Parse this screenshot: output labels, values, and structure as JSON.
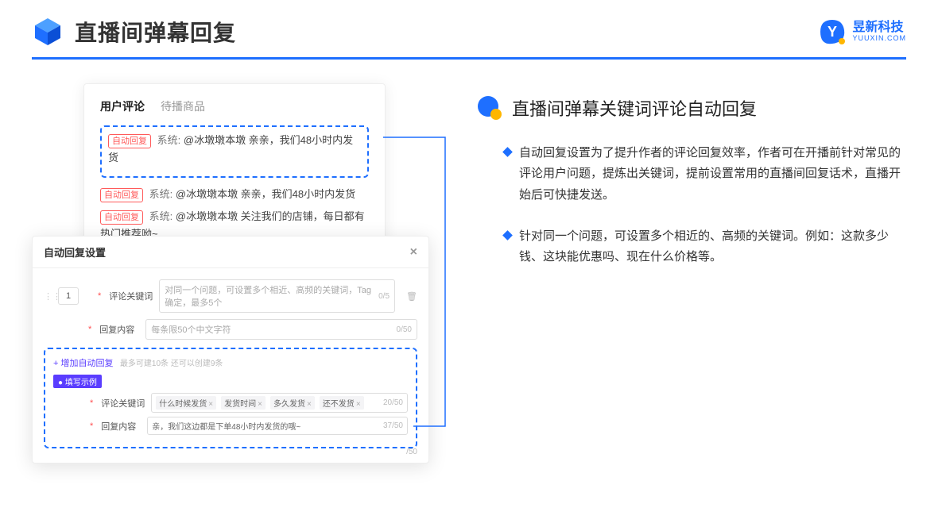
{
  "header": {
    "title": "直播间弹幕回复",
    "brand_cn": "昱新科技",
    "brand_en": "YUUXIN.COM"
  },
  "comment_panel": {
    "tabs": [
      "用户评论",
      "待播商品"
    ],
    "active_tab": 0,
    "highlighted": {
      "pill": "自动回复",
      "prefix": "系统:",
      "text": "@冰墩墩本墩 亲亲，我们48小时内发货"
    },
    "lines": [
      {
        "pill": "自动回复",
        "prefix": "系统:",
        "text": "@冰墩墩本墩 亲亲，我们48小时内发货"
      },
      {
        "pill": "自动回复",
        "prefix": "系统:",
        "text": "@冰墩墩本墩 关注我们的店铺，每日都有热门推荐呦~"
      }
    ]
  },
  "modal": {
    "title": "自动回复设置",
    "close": "×",
    "row_number": "1",
    "keyword_label": "评论关键词",
    "keyword_placeholder": "对同一个问题，可设置多个相近、高频的关键词，Tag确定，最多5个",
    "keyword_count": "0/5",
    "content_label": "回复内容",
    "content_placeholder": "每条限50个中文字符",
    "content_count": "0/50",
    "add_label": "+ 增加自动回复",
    "add_hint": "最多可建10条 还可以创建9条",
    "example_badge": "● 填写示例",
    "example_keyword_label": "评论关键词",
    "example_tags": [
      "什么时候发货",
      "发货时间",
      "多久发货",
      "还不发货"
    ],
    "example_keyword_count": "20/50",
    "example_content_label": "回复内容",
    "example_content_text": "亲，我们这边都是下单48小时内发货的哦~",
    "example_content_count": "37/50",
    "stray_count": "/50"
  },
  "right": {
    "section_title": "直播间弹幕关键词评论自动回复",
    "bullets": [
      "自动回复设置为了提升作者的评论回复效率，作者可在开播前针对常见的评论用户问题，提炼出关键词，提前设置常用的直播间回复话术，直播开始后可快捷发送。",
      "针对同一个问题，可设置多个相近的、高频的关键词。例如：这款多少钱、这块能优惠吗、现在什么价格等。"
    ]
  }
}
